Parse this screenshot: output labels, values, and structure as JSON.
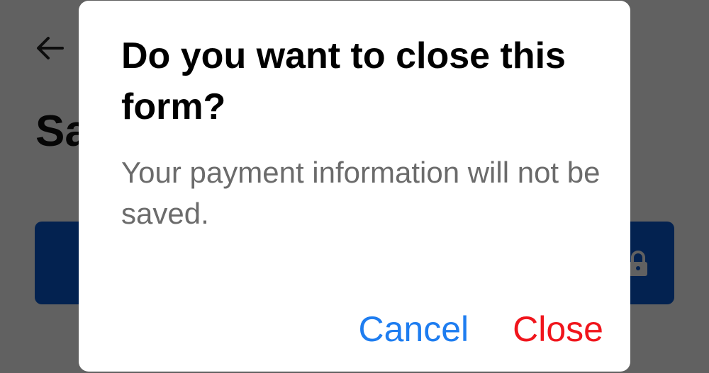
{
  "background_page": {
    "title": "Sa",
    "back_icon": "arrow-left-icon",
    "pay_button_icon": "lock-icon",
    "pay_button_color": "#0a5bd3"
  },
  "dialog": {
    "title": "Do you want to close this form?",
    "message": "Your payment information will not be saved.",
    "cancel_label": "Cancel",
    "close_label": "Close",
    "cancel_color": "#1e7df0",
    "close_color": "#f0151c"
  }
}
